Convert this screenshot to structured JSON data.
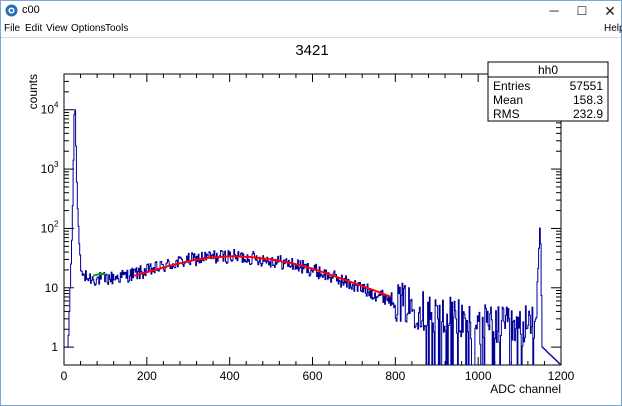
{
  "window": {
    "title": "c00",
    "minimize_glyph": "─",
    "maximize_glyph": "☐",
    "close_glyph": "✕",
    "icon": "root-logo-icon"
  },
  "menu": {
    "file": "File",
    "edit": "Edit",
    "view": "View",
    "options": "Options",
    "tools": "Tools",
    "help": "Help"
  },
  "stats_box": {
    "name": "hh0",
    "rows": [
      {
        "label": "Entries",
        "value": "57551"
      },
      {
        "label": "Mean",
        "value": "158.3"
      },
      {
        "label": "RMS",
        "value": "232.9"
      }
    ]
  },
  "chart_data": {
    "type": "histogram",
    "title": "3421",
    "xlabel": "ADC channel",
    "ylabel": "counts",
    "xlim": [
      0,
      1200
    ],
    "ylim": [
      0.5,
      40000
    ],
    "y_scale": "log",
    "grid": false,
    "x_tick_labels": [
      "0",
      "200",
      "400",
      "600",
      "800",
      "1000",
      "1200"
    ],
    "y_tick_labels": [
      {
        "value": 1,
        "base": "1",
        "exp": ""
      },
      {
        "value": 10,
        "base": "10",
        "exp": ""
      },
      {
        "value": 100,
        "base": "10",
        "exp": "2"
      },
      {
        "value": 1000,
        "base": "10",
        "exp": "3"
      },
      {
        "value": 10000,
        "base": "10",
        "exp": "4"
      }
    ],
    "histogram_color": "#000099",
    "fit_color": "#ff0000",
    "marker_color": "#00aa00",
    "histogram_profile": [
      {
        "x": 0,
        "y": 1
      },
      {
        "x": 10,
        "y": 1
      },
      {
        "x": 20,
        "y": 100
      },
      {
        "x": 26,
        "y": 20000
      },
      {
        "x": 32,
        "y": 300
      },
      {
        "x": 40,
        "y": 20
      },
      {
        "x": 50,
        "y": 15
      },
      {
        "x": 80,
        "y": 14
      },
      {
        "x": 100,
        "y": 14
      },
      {
        "x": 150,
        "y": 16
      },
      {
        "x": 200,
        "y": 19
      },
      {
        "x": 250,
        "y": 24
      },
      {
        "x": 300,
        "y": 29
      },
      {
        "x": 350,
        "y": 33
      },
      {
        "x": 400,
        "y": 34
      },
      {
        "x": 450,
        "y": 32
      },
      {
        "x": 500,
        "y": 29
      },
      {
        "x": 550,
        "y": 25
      },
      {
        "x": 600,
        "y": 20
      },
      {
        "x": 650,
        "y": 15
      },
      {
        "x": 700,
        "y": 11
      },
      {
        "x": 750,
        "y": 8
      },
      {
        "x": 800,
        "y": 6
      },
      {
        "x": 850,
        "y": 4.5
      },
      {
        "x": 900,
        "y": 3.5
      },
      {
        "x": 1000,
        "y": 2.5
      },
      {
        "x": 1100,
        "y": 2
      },
      {
        "x": 1140,
        "y": 3
      },
      {
        "x": 1150,
        "y": 150
      },
      {
        "x": 1155,
        "y": 1
      },
      {
        "x": 1200,
        "y": 0.5
      }
    ],
    "fit_curve": {
      "x_range": [
        170,
        790
      ],
      "points": [
        {
          "x": 170,
          "y": 16
        },
        {
          "x": 250,
          "y": 23
        },
        {
          "x": 300,
          "y": 28
        },
        {
          "x": 350,
          "y": 32
        },
        {
          "x": 400,
          "y": 34
        },
        {
          "x": 450,
          "y": 33
        },
        {
          "x": 500,
          "y": 30
        },
        {
          "x": 550,
          "y": 26
        },
        {
          "x": 600,
          "y": 21
        },
        {
          "x": 650,
          "y": 16
        },
        {
          "x": 700,
          "y": 12
        },
        {
          "x": 750,
          "y": 9
        },
        {
          "x": 790,
          "y": 7
        }
      ]
    },
    "background_fit": {
      "x_range": [
        70,
        100
      ],
      "points": [
        {
          "x": 70,
          "y": 16
        },
        {
          "x": 85,
          "y": 17
        },
        {
          "x": 100,
          "y": 17
        }
      ]
    }
  }
}
